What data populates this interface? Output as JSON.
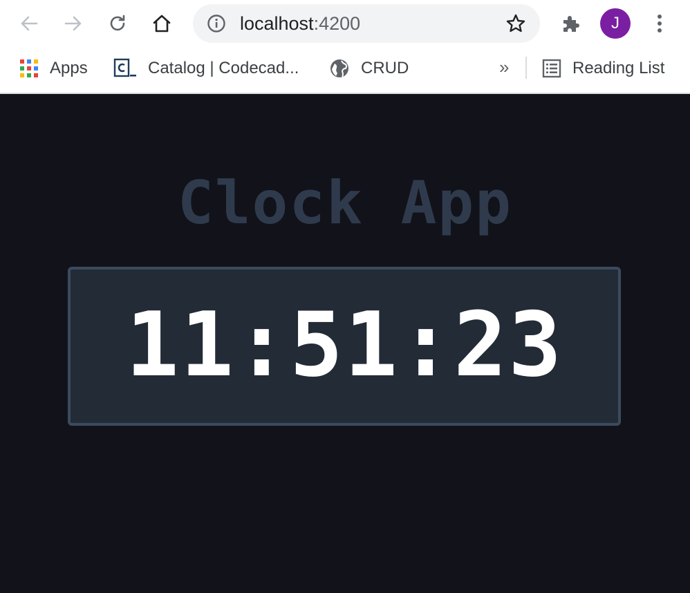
{
  "browser": {
    "url_host": "localhost",
    "url_port": ":4200",
    "avatar_initial": "J"
  },
  "bookmarks": {
    "items": [
      {
        "label": "Apps",
        "icon": "apps-grid-icon"
      },
      {
        "label": "Catalog | Codecad...",
        "icon": "codecademy-icon"
      },
      {
        "label": "CRUD",
        "icon": "globe-icon"
      }
    ],
    "overflow": "»",
    "reading_list": "Reading List"
  },
  "app": {
    "title": "Clock App",
    "time": "11:51:23"
  },
  "colors": {
    "page_bg": "#12131a",
    "title": "#2f3b4d",
    "clock_bg": "#232b36",
    "clock_border": "#3b4b5e",
    "clock_text": "#ffffff",
    "avatar": "#7b1fa2"
  }
}
